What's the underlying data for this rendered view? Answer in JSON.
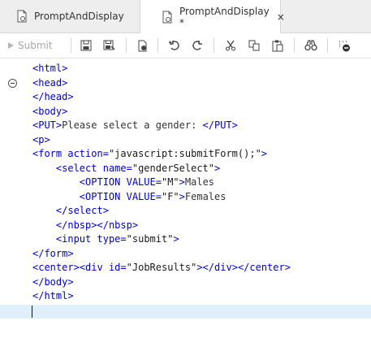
{
  "tabs": [
    {
      "label": "PromptAndDisplay",
      "active": false
    },
    {
      "label": "PromptAndDisplay *",
      "active": true,
      "close": "×"
    }
  ],
  "toolbar": {
    "submit_label": "Submit",
    "icons": [
      "save-icon",
      "save-as-icon",
      "run-icon",
      "undo-icon",
      "redo-icon",
      "cut-icon",
      "copy-icon",
      "paste-icon",
      "find-icon",
      "clear-icon"
    ]
  },
  "code_lines": [
    "<html>",
    "<head>",
    "</head>",
    "<body>",
    "<PUT>Please select a gender: </PUT>",
    "<p>",
    "<form action=\"javascript:submitForm();\">",
    "    <select name=\"genderSelect\">",
    "        <OPTION VALUE=\"M\">Males",
    "        <OPTION VALUE=\"F\">Females",
    "    </select>",
    "    </nbsp></nbsp>",
    "    <input type=\"submit\">",
    "</form>",
    "<center><div id=\"JobResults\"></div></center>",
    "</body>",
    "</html>"
  ],
  "colors": {
    "tag": "#0000c8",
    "text": "#333333",
    "current_line": "#dfeffb"
  }
}
